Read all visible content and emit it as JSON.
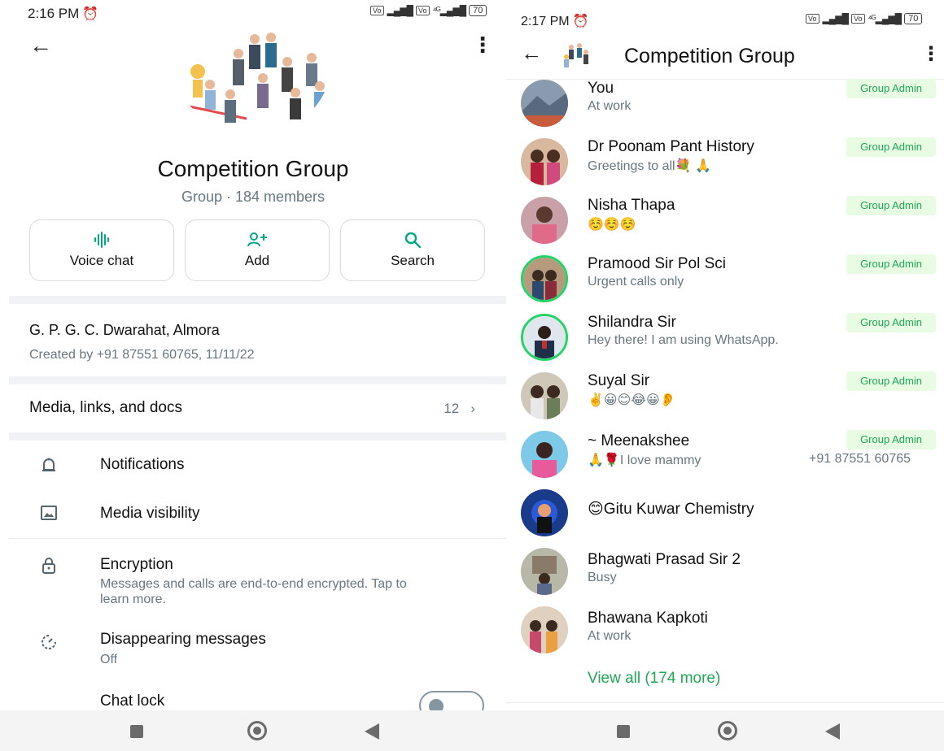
{
  "left": {
    "status_time": "2:16 PM",
    "battery": "70",
    "group_name": "Competition Group",
    "group_sub": "Group · 184 members",
    "actions": [
      {
        "label": "Voice chat",
        "icon": "voice-wave-icon"
      },
      {
        "label": "Add",
        "icon": "add-person-icon"
      },
      {
        "label": "Search",
        "icon": "search-icon"
      }
    ],
    "description": "G. P. G. C. Dwarahat, Almora",
    "created": "Created by +91 87551 60765, 11/11/22",
    "media_label": "Media, links, and docs",
    "media_count": "12",
    "settings": [
      {
        "label": "Notifications",
        "icon": "bell-icon"
      },
      {
        "label": "Media visibility",
        "icon": "image-icon"
      },
      {
        "label": "Encryption",
        "icon": "lock-icon",
        "sub": "Messages and calls are end-to-end encrypted. Tap to learn more."
      },
      {
        "label": "Disappearing messages",
        "icon": "timer-icon",
        "sub": "Off"
      },
      {
        "label": "Chat lock",
        "icon": "chat-lock-icon"
      }
    ]
  },
  "right": {
    "status_time": "2:17 PM",
    "battery": "70",
    "title": "Competition Group",
    "admin_badge": "Group Admin",
    "members": [
      {
        "name": "You",
        "status": "At work",
        "admin": true
      },
      {
        "name": "Dr Poonam Pant History",
        "status": "Greetings to all💐 🙏",
        "admin": true
      },
      {
        "name": "Nisha Thapa",
        "status": "☺️☺️☺️",
        "admin": true
      },
      {
        "name": "Pramood Sir Pol Sci",
        "status": "Urgent calls only",
        "admin": true
      },
      {
        "name": "Shilandra Sir",
        "status": "Hey there! I am using WhatsApp.",
        "admin": true
      },
      {
        "name": "Suyal Sir",
        "status": "✌️😀😊😂😀👂",
        "admin": true
      },
      {
        "name": "~ Meenakshee",
        "status": "🙏🌹I love mammy",
        "admin": true,
        "phone": "+91 87551 60765"
      },
      {
        "name": "😊Gitu Kuwar Chemistry",
        "status": "",
        "admin": false
      },
      {
        "name": "Bhagwati Prasad Sir 2",
        "status": "Busy",
        "admin": false
      },
      {
        "name": "Bhawana Kapkoti",
        "status": "At work",
        "admin": false
      }
    ],
    "view_all": "View all (174 more)"
  },
  "colors": {
    "accent": "#00a884",
    "admin_bg": "#e7fce3",
    "admin_text": "#1fa855",
    "muted": "#667781"
  }
}
